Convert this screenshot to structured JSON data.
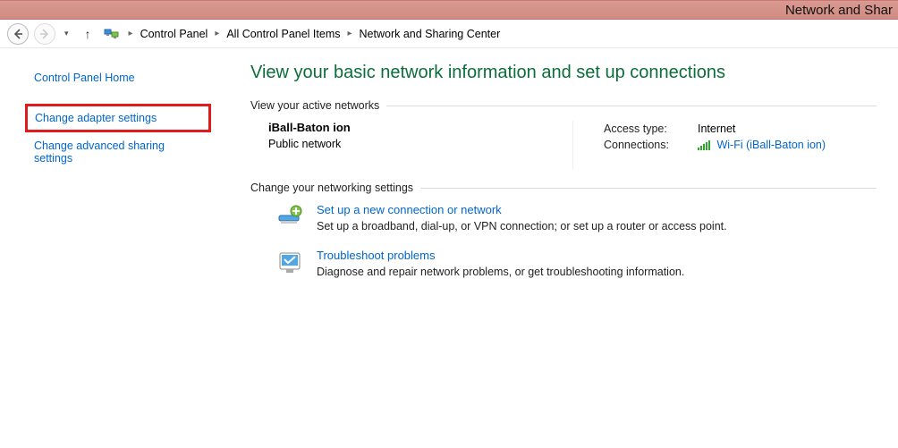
{
  "titlebar": {
    "caption": "Network and Shar"
  },
  "toolbar": {
    "breadcrumb": {
      "item1": "Control Panel",
      "item2": "All Control Panel Items",
      "item3": "Network and Sharing Center"
    }
  },
  "sidebar": {
    "home": "Control Panel Home",
    "adapter": "Change adapter settings",
    "advanced": "Change advanced sharing settings"
  },
  "main": {
    "page_title": "View your basic network information and set up connections",
    "active_header": "View your active networks",
    "network": {
      "name": "iBall-Baton ion",
      "type": "Public network",
      "access_label": "Access type:",
      "access_value": "Internet",
      "conn_label": "Connections:",
      "conn_link": "Wi-Fi (iBall-Baton ion)"
    },
    "change_header": "Change your networking settings",
    "setup": {
      "title": "Set up a new connection or network",
      "desc": "Set up a broadband, dial-up, or VPN connection; or set up a router or access point."
    },
    "troubleshoot": {
      "title": "Troubleshoot problems",
      "desc": "Diagnose and repair network problems, or get troubleshooting information."
    }
  }
}
